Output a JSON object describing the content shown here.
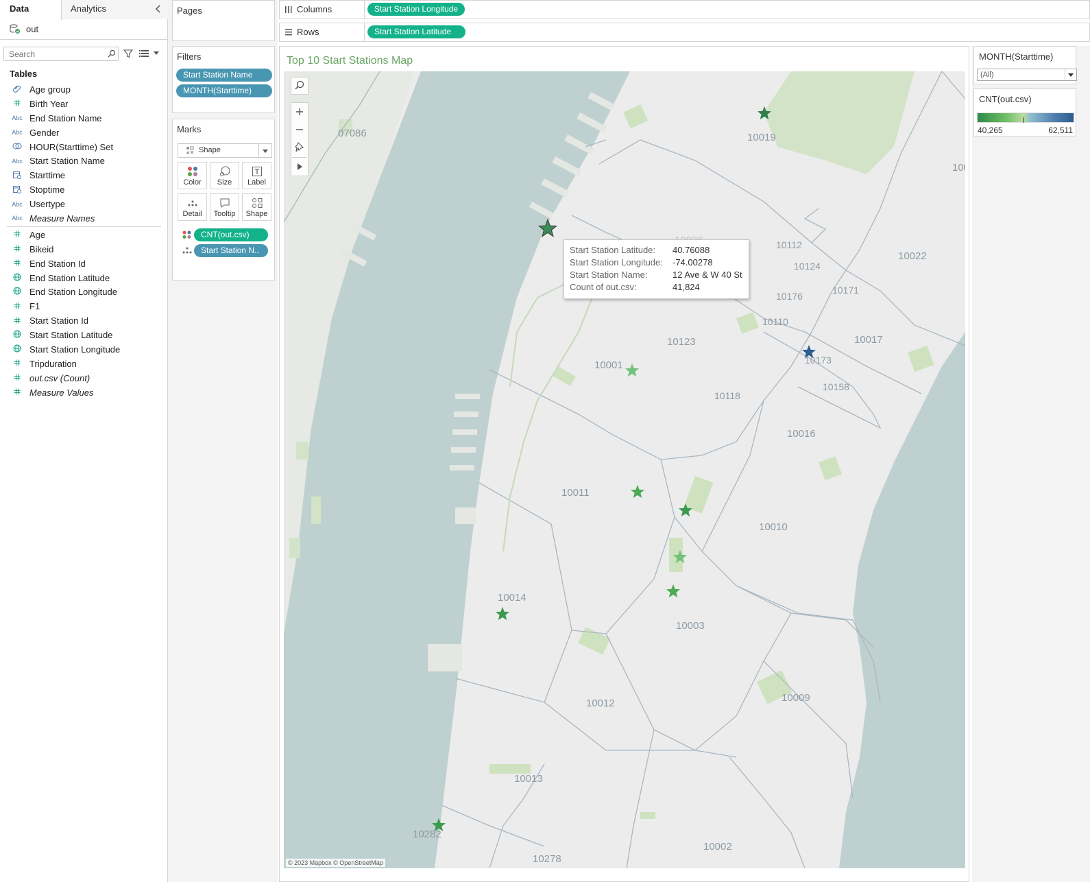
{
  "data_pane": {
    "tab_data": "Data",
    "tab_analytics": "Analytics",
    "datasource": "out",
    "search_placeholder": "Search",
    "tables_header": "Tables",
    "dimensions": [
      {
        "icon": "paperclip-icon",
        "type": "group",
        "label": "Age group"
      },
      {
        "icon": "hash-icon",
        "type": "#",
        "label": "Birth Year"
      },
      {
        "icon": "abc-icon",
        "type": "Abc",
        "label": "End Station Name"
      },
      {
        "icon": "abc-icon",
        "type": "Abc",
        "label": "Gender"
      },
      {
        "icon": "set-icon",
        "type": "set",
        "label": "HOUR(Starttime) Set"
      },
      {
        "icon": "abc-icon",
        "type": "Abc",
        "label": "Start Station Name"
      },
      {
        "icon": "calendar-icon",
        "type": "date",
        "label": "Starttime"
      },
      {
        "icon": "calendar-icon",
        "type": "date",
        "label": "Stoptime"
      },
      {
        "icon": "abc-icon",
        "type": "Abc",
        "label": "Usertype"
      },
      {
        "icon": "abc-icon",
        "type": "Abc",
        "label": "Measure Names",
        "italic": true
      }
    ],
    "measures": [
      {
        "icon": "hash-icon",
        "type": "#",
        "label": "Age"
      },
      {
        "icon": "hash-icon",
        "type": "#",
        "label": "Bikeid"
      },
      {
        "icon": "hash-icon",
        "type": "#",
        "label": "End Station Id"
      },
      {
        "icon": "globe-icon",
        "type": "geo",
        "label": "End Station Latitude"
      },
      {
        "icon": "globe-icon",
        "type": "geo",
        "label": "End Station Longitude"
      },
      {
        "icon": "hash-icon",
        "type": "#",
        "label": "F1"
      },
      {
        "icon": "hash-icon",
        "type": "#",
        "label": "Start Station Id"
      },
      {
        "icon": "globe-icon",
        "type": "geo",
        "label": "Start Station Latitude"
      },
      {
        "icon": "globe-icon",
        "type": "geo",
        "label": "Start Station Longitude"
      },
      {
        "icon": "hash-icon",
        "type": "#",
        "label": "Tripduration"
      },
      {
        "icon": "hash-icon",
        "type": "#",
        "label": "out.csv (Count)",
        "italic": true
      },
      {
        "icon": "hash-icon",
        "type": "#",
        "label": "Measure Values",
        "italic": true
      }
    ]
  },
  "shelves": {
    "pages_title": "Pages",
    "filters_title": "Filters",
    "filters": [
      "Start Station Name",
      "MONTH(Starttime)"
    ],
    "marks_title": "Marks",
    "mark_type": "Shape",
    "mark_buttons": {
      "color": "Color",
      "size": "Size",
      "label": "Label",
      "detail": "Detail",
      "tooltip": "Tooltip",
      "shape": "Shape"
    },
    "mark_fields": [
      "CNT(out.csv)",
      "Start Station N.."
    ],
    "columns_label": "Columns",
    "columns_pill": "Start Station Longitude",
    "rows_label": "Rows",
    "rows_pill": "Start Station Latitude"
  },
  "view": {
    "title": "Top 10 Start Stations Map",
    "attribution": "© 2023 Mapbox © OpenStreetMap",
    "zip_labels": [
      "07086",
      "10019",
      "10036",
      "10112",
      "10124",
      "10022",
      "10176",
      "10171",
      "10110",
      "10017",
      "10123",
      "10173",
      "10001",
      "10118",
      "10158",
      "10016",
      "10011",
      "10010",
      "10014",
      "10003",
      "10012",
      "10009",
      "10013",
      "10282",
      "10278",
      "10002",
      "100"
    ],
    "tooltip": {
      "rows": [
        {
          "key": "Start Station Latitude:",
          "value": "40.76088"
        },
        {
          "key": "Start Station Longitude:",
          "value": "-74.00278"
        },
        {
          "key": "Start Station Name:",
          "value": "12 Ave & W 40 St"
        },
        {
          "key": "Count of out.csv:",
          "value": "41,824"
        }
      ]
    },
    "colors": {
      "water": "#bfd0d0",
      "land": "#ececec",
      "park": "#cfe2c0",
      "boundary": "#a9b7c2",
      "title": "#68a665",
      "star_green_dark": "#2f7f4a",
      "star_green_mid": "#4caa55",
      "star_green_light": "#73c27a",
      "star_blue": "#2f5d8f"
    }
  },
  "legends": {
    "month_title": "MONTH(Starttime)",
    "month_value": "(All)",
    "count_title": "CNT(out.csv)",
    "count_min": "40,265",
    "count_max": "62,511"
  }
}
